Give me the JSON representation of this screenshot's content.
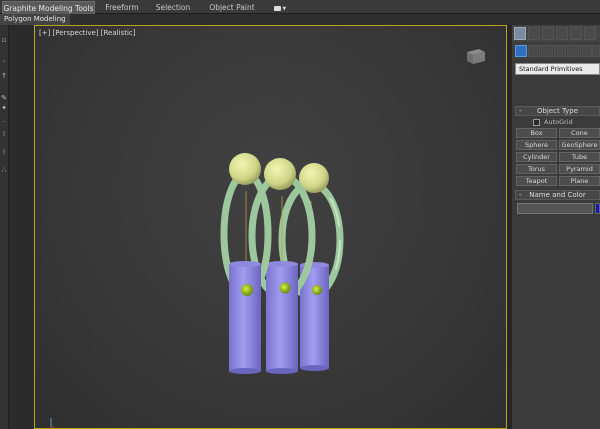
{
  "ribbon": {
    "tabs": [
      {
        "label": "Graphite Modeling Tools",
        "active": true
      },
      {
        "label": "Freeform",
        "active": false
      },
      {
        "label": "Selection",
        "active": false
      },
      {
        "label": "Object Paint",
        "active": false
      }
    ],
    "extra_icon": "camera-icon",
    "subtab": "Polygon Modeling"
  },
  "viewport": {
    "label": "[+] [Perspective] [Realistic]",
    "border_color": "#b9a41a",
    "objects": [
      {
        "name": "pendant-left",
        "ring_color": "#a9d3a9",
        "ball_color": "#d7dd8f",
        "cylinder_color": "#8f89e0"
      },
      {
        "name": "pendant-middle",
        "ring_color": "#a9d3a9",
        "ball_color": "#d7dd8f",
        "cylinder_color": "#8f89e0"
      },
      {
        "name": "pendant-right",
        "ring_color": "#a9d3a9",
        "ball_color": "#d7dd8f",
        "cylinder_color": "#8f89e0"
      }
    ]
  },
  "command_panel": {
    "tab_icons": [
      "create-icon",
      "modify-icon",
      "hierarchy-icon",
      "motion-icon",
      "display-icon",
      "utilities-icon"
    ],
    "category_icons": [
      "geometry-icon",
      "shapes-icon",
      "lights-icon",
      "cameras-icon",
      "helpers-icon",
      "spacewarps-icon",
      "systems-icon"
    ],
    "primitive_type": "Standard Primitives",
    "object_type": {
      "title": "Object Type",
      "autogrid": "AutoGrid",
      "buttons": [
        "Box",
        "Cone",
        "Sphere",
        "GeoSphere",
        "Cylinder",
        "Tube",
        "Torus",
        "Pyramid",
        "Teapot",
        "Plane"
      ]
    },
    "name_and_color": {
      "title": "Name and Color",
      "swatch_color": "#1818c0"
    }
  }
}
